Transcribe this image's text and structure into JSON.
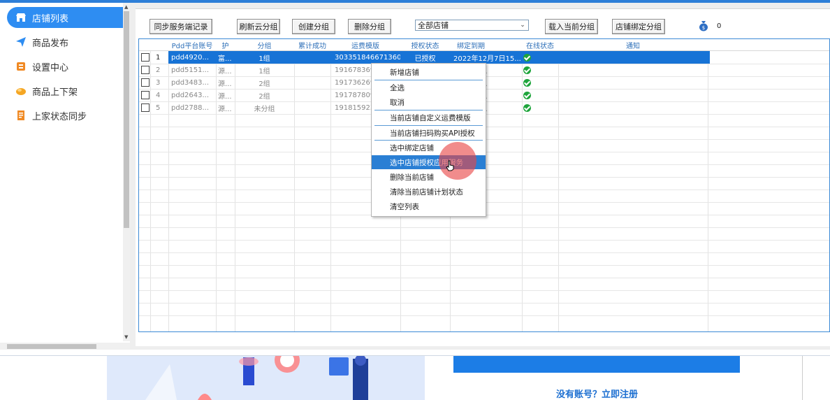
{
  "sidebar": {
    "items": [
      {
        "label": "店铺列表",
        "icon": "store-icon",
        "active": true
      },
      {
        "label": "商品发布",
        "icon": "send-icon",
        "active": false
      },
      {
        "label": "设置中心",
        "icon": "settings-icon",
        "active": false
      },
      {
        "label": "商品上下架",
        "icon": "shelf-icon",
        "active": false
      },
      {
        "label": "上家状态同步",
        "icon": "sync-icon",
        "active": false
      }
    ]
  },
  "toolbar": {
    "sync_records": "同步服务端记录",
    "refresh_groups": "刷新云分组",
    "create_group": "创建分组",
    "delete_group": "删除分组",
    "store_select": "全部店铺",
    "load_group": "载入当前分组",
    "bind_group": "店铺绑定分组",
    "count": "0"
  },
  "table": {
    "headers": [
      "Pdd平台账号",
      "护",
      "分组",
      "累计成功",
      "运费模版",
      "授权状态",
      "绑定到期",
      "在线状态",
      "通知"
    ],
    "rows": [
      {
        "no": "1",
        "account": "pdd4920...",
        "maint": "富...",
        "group": "1组",
        "freight": "303351846671360",
        "auth": "已授权",
        "expiry": "2022年12月7日15...",
        "online": "ok"
      },
      {
        "no": "2",
        "account": "pdd5151...",
        "maint": "源...",
        "group": "1组",
        "freight": "191678369",
        "auth": "",
        "expiry": "月7日15...",
        "online": "ok"
      },
      {
        "no": "3",
        "account": "pdd3483...",
        "maint": "源...",
        "group": "2组",
        "freight": "191736269",
        "auth": "",
        "expiry": "月7日12...",
        "online": "ok"
      },
      {
        "no": "4",
        "account": "pdd2643...",
        "maint": "源...",
        "group": "2组",
        "freight": "191787809",
        "auth": "",
        "expiry": "月7日12...",
        "online": "ok"
      },
      {
        "no": "5",
        "account": "pdd2788...",
        "maint": "源...",
        "group": "未分组",
        "freight": "191815923",
        "auth": "",
        "expiry": "月7日11...",
        "online": "ok"
      }
    ]
  },
  "context_menu": {
    "items": [
      "新增店铺",
      "全选",
      "取消",
      "当前店铺自定义运费模版",
      "当前店铺扫码购买API授权",
      "选中绑定店铺",
      "选中店铺授权应用服务",
      "删除当前店铺",
      "清除当前店铺计划状态",
      "清空列表"
    ],
    "highlighted_index": 6
  },
  "bottom": {
    "register_text": "没有账号？立即注册"
  },
  "colors": {
    "accent": "#2e8df2",
    "selection": "#1773d6",
    "menu_highlight": "#2a7fd4",
    "online_ok": "#1fa53c"
  }
}
